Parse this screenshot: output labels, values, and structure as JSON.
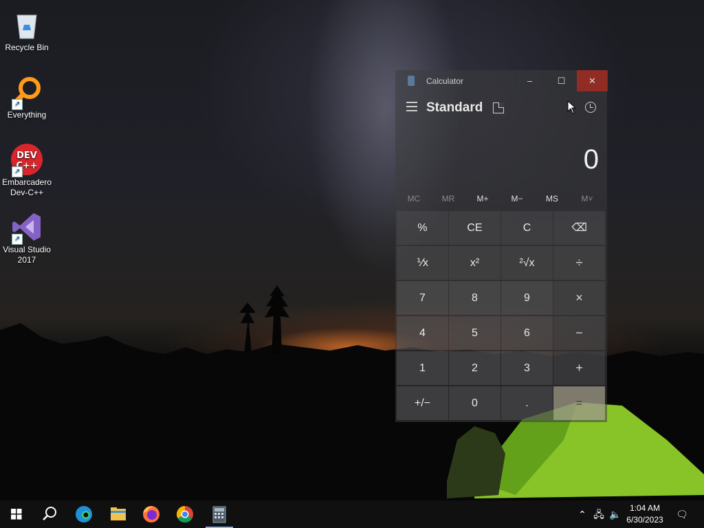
{
  "desktop": {
    "icons": [
      {
        "label": "Recycle Bin",
        "icon": "recycle-bin-icon"
      },
      {
        "label": "Everything",
        "icon": "everything-search-icon"
      },
      {
        "label": "Embarcadero Dev-C++",
        "icon": "devcpp-icon",
        "logo_text": "DEV C++"
      },
      {
        "label": "Visual Studio 2017",
        "icon": "visual-studio-icon"
      }
    ]
  },
  "calculator": {
    "window_title": "Calculator",
    "mode": "Standard",
    "display": "0",
    "controls": {
      "minimize": "–",
      "maximize": "☐",
      "close": "✕"
    },
    "memory": [
      "MC",
      "MR",
      "M+",
      "M−",
      "MS",
      "M˅"
    ],
    "memory_enabled": [
      false,
      false,
      true,
      true,
      true,
      false
    ],
    "keys": [
      [
        "%",
        "CE",
        "C",
        "⌫"
      ],
      [
        "⅟x",
        "x²",
        "²√x",
        "÷"
      ],
      [
        "7",
        "8",
        "9",
        "×"
      ],
      [
        "4",
        "5",
        "6",
        "−"
      ],
      [
        "1",
        "2",
        "3",
        "+"
      ],
      [
        "+/−",
        "0",
        ".",
        "="
      ]
    ]
  },
  "taskbar": {
    "items": [
      "start-icon",
      "search-icon",
      "edge-icon",
      "file-explorer-icon",
      "firefox-icon",
      "chrome-icon",
      "calculator-icon"
    ],
    "active": "calculator-icon",
    "time": "1:04 AM",
    "date": "6/30/2023",
    "colors": {
      "accent": "#7eb6ff",
      "close_hover": "#c42b1c"
    }
  }
}
